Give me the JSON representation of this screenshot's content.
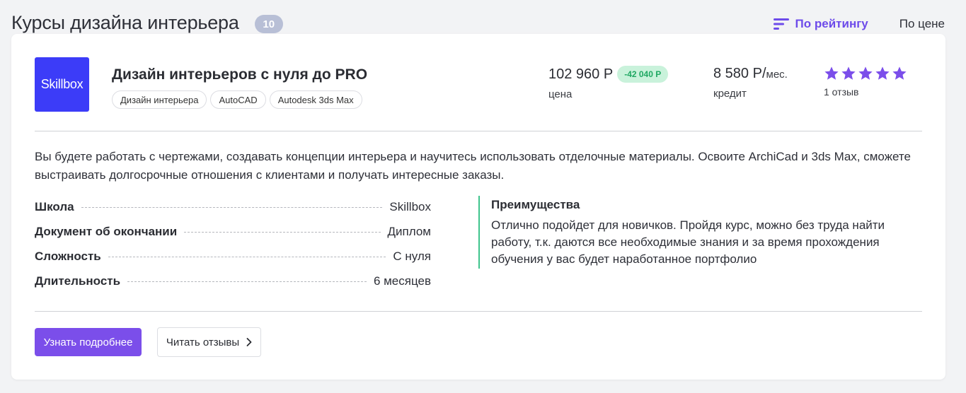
{
  "header": {
    "title": "Курсы дизайна интерьера",
    "count": "10",
    "sort_rating_label": "По рейтингу",
    "sort_price_label": "По цене",
    "accent_color": "#6d4bea"
  },
  "course": {
    "logo_text": "Skillbox",
    "logo_color": "#3c3cf8",
    "title": "Дизайн интерьеров с нуля до PRO",
    "tags": [
      "Дизайн интерьера",
      "AutoCAD",
      "Autodesk 3ds Max"
    ],
    "price": "102 960 Р",
    "discount": "-42 040 Р",
    "price_label": "цена",
    "credit": "8 580 Р/",
    "credit_unit": "мес.",
    "credit_label": "кредит",
    "rating_stars": 5,
    "reviews_count": "1 отзыв",
    "description": "Вы будете работать с чертежами, создавать концепции интерьера и научитесь использовать отделочные материалы. Освоите ArchiCad и 3ds Max, сможете выстраивать долгосрочные отношения с клиентами и получать интересные заказы.",
    "details": [
      {
        "key": "Школа",
        "value": "Skillbox"
      },
      {
        "key": "Документ об окончании",
        "value": "Диплом"
      },
      {
        "key": "Сложность",
        "value": "С нуля"
      },
      {
        "key": "Длительность",
        "value": "6 месяцев"
      }
    ],
    "advantages_title": "Преимущества",
    "advantages_text": "Отлично подойдет для новичков. Пройдя курс, можно без труда найти работу, т.к. даются все необходимые знания и за время прохождения обучения у вас будет наработанное портфолио",
    "btn_more": "Узнать подробнее",
    "btn_reviews": "Читать отзывы"
  }
}
